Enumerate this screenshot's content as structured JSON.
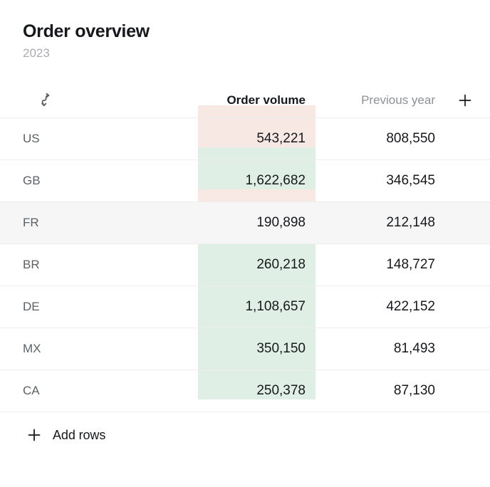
{
  "card": {
    "title": "Order overview",
    "subtitle": "2023"
  },
  "table": {
    "header": {
      "sort_icon": "swap-arrows-icon",
      "col_primary": "Order volume",
      "col_secondary": "Previous year",
      "add_column_icon": "plus-icon"
    },
    "rows": [
      {
        "label": "US",
        "order_volume": "543,221",
        "previous_year": "808,550",
        "trend": "down",
        "hover": false
      },
      {
        "label": "GB",
        "order_volume": "1,622,682",
        "previous_year": "346,545",
        "trend": "up",
        "hover": false
      },
      {
        "label": "FR",
        "order_volume": "190,898",
        "previous_year": "212,148",
        "trend": "down",
        "hover": true
      },
      {
        "label": "BR",
        "order_volume": "260,218",
        "previous_year": "148,727",
        "trend": "up",
        "hover": false
      },
      {
        "label": "DE",
        "order_volume": "1,108,657",
        "previous_year": "422,152",
        "trend": "up",
        "hover": false
      },
      {
        "label": "MX",
        "order_volume": "350,150",
        "previous_year": "81,493",
        "trend": "up",
        "hover": false
      },
      {
        "label": "CA",
        "order_volume": "250,378",
        "previous_year": "87,130",
        "trend": "up",
        "hover": false
      }
    ]
  },
  "footer": {
    "add_rows_label": "Add rows",
    "add_rows_icon": "plus-icon"
  },
  "colors": {
    "trend_up_bg": "#dfefe5",
    "trend_down_bg": "#f8e8e3",
    "row_hover_bg": "#f6f6f6",
    "row_border": "#ededed",
    "text_primary": "#16181b",
    "text_muted": "#8d9195",
    "label_text": "#5d6165",
    "subtitle_text": "#a9acb0",
    "card_bg": "#ffffff"
  }
}
